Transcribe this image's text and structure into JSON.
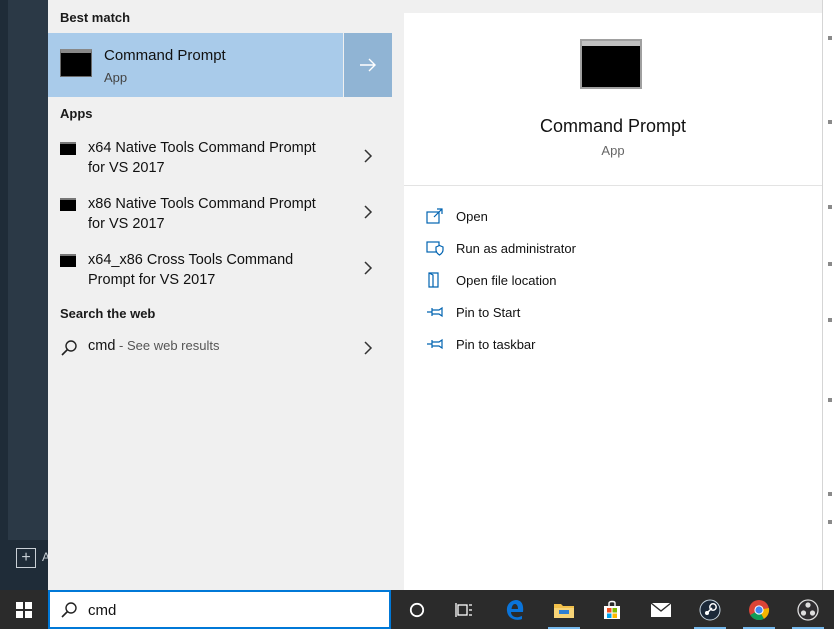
{
  "desktop": {
    "add_app_label": "A"
  },
  "sections": {
    "best_match": "Best match",
    "apps": "Apps",
    "search_web": "Search the web"
  },
  "best_match": {
    "title": "Command Prompt",
    "subtitle": "App"
  },
  "apps": [
    {
      "line1": "x64 Native Tools Command Prompt",
      "line2": "for VS 2017"
    },
    {
      "line1": "x86 Native Tools Command Prompt",
      "line2": "for VS 2017"
    },
    {
      "line1": "x64_x86 Cross Tools Command",
      "line2": "Prompt for VS 2017"
    }
  ],
  "web_result": {
    "query": "cmd",
    "separator": " - ",
    "hint": "See web results"
  },
  "preview": {
    "title": "Command Prompt",
    "subtitle": "App",
    "actions": [
      {
        "label": "Open",
        "icon": "open-icon"
      },
      {
        "label": "Run as administrator",
        "icon": "shield-icon"
      },
      {
        "label": "Open file location",
        "icon": "folder-location-icon"
      },
      {
        "label": "Pin to Start",
        "icon": "pin-icon"
      },
      {
        "label": "Pin to taskbar",
        "icon": "pin-icon"
      }
    ]
  },
  "search": {
    "value": "cmd"
  },
  "colors": {
    "accent": "#0078d7",
    "selected": "#a9cbea",
    "icon_blue": "#0063b1"
  }
}
